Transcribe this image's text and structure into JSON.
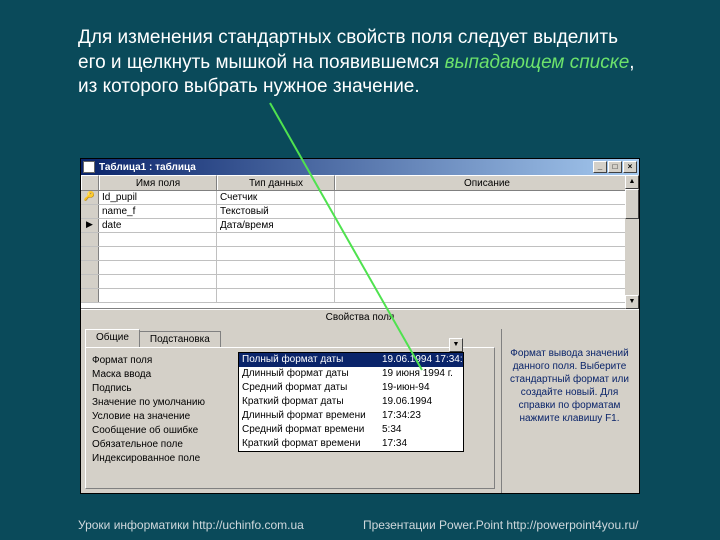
{
  "instruction": {
    "part1": "Для изменения стандартных свойств поля следует выделить его и щелкнуть мышкой на появившемся ",
    "emph": "выпадающем списке",
    "part2": ", из которого выбрать нужное значение."
  },
  "window": {
    "title": "Таблица1 : таблица",
    "min": "_",
    "max": "□",
    "close": "×"
  },
  "grid": {
    "headers": {
      "name": "Имя поля",
      "type": "Тип данных",
      "desc": "Описание"
    },
    "rows": [
      {
        "sel": "🔑",
        "name": "Id_pupil",
        "type": "Счетчик",
        "desc": ""
      },
      {
        "sel": "",
        "name": "name_f",
        "type": "Текстовый",
        "desc": ""
      },
      {
        "sel": "▶",
        "name": "date",
        "type": "Дата/время",
        "desc": ""
      },
      {
        "sel": "",
        "name": "",
        "type": "",
        "desc": ""
      },
      {
        "sel": "",
        "name": "",
        "type": "",
        "desc": ""
      },
      {
        "sel": "",
        "name": "",
        "type": "",
        "desc": ""
      },
      {
        "sel": "",
        "name": "",
        "type": "",
        "desc": ""
      },
      {
        "sel": "",
        "name": "",
        "type": "",
        "desc": ""
      }
    ]
  },
  "props": {
    "caption": "Свойства поля",
    "tabs": {
      "general": "Общие",
      "lookup": "Подстановка"
    },
    "fields": [
      {
        "label": "Формат поля",
        "value": ""
      },
      {
        "label": "Маска ввода",
        "value": ""
      },
      {
        "label": "Подпись",
        "value": ""
      },
      {
        "label": "Значение по умолчанию",
        "value": ""
      },
      {
        "label": "Условие на значение",
        "value": ""
      },
      {
        "label": "Сообщение об ошибке",
        "value": ""
      },
      {
        "label": "Обязательное поле",
        "value": ""
      },
      {
        "label": "Индексированное поле",
        "value": ""
      }
    ],
    "dropdown": [
      {
        "label": "Полный формат даты",
        "example": "19.06.1994 17:34:",
        "selected": true
      },
      {
        "label": "Длинный формат даты",
        "example": "19 июня 1994 г."
      },
      {
        "label": "Средний формат даты",
        "example": "19-июн-94"
      },
      {
        "label": "Краткий формат даты",
        "example": "19.06.1994"
      },
      {
        "label": "Длинный формат времени",
        "example": "17:34:23"
      },
      {
        "label": "Средний формат времени",
        "example": "5:34"
      },
      {
        "label": "Краткий формат времени",
        "example": "17:34"
      }
    ],
    "dropdown_arrow": "▼",
    "hint": "Формат вывода значений данного поля. Выберите стандартный формат или создайте новый. Для справки по форматам нажмите клавишу F1."
  },
  "scrollbar": {
    "up": "▲",
    "down": "▼"
  },
  "footer": {
    "left": "Уроки информатики  http://uchinfo.com.ua",
    "right": "Презентации Power.Point  http://powerpoint4you.ru/"
  }
}
